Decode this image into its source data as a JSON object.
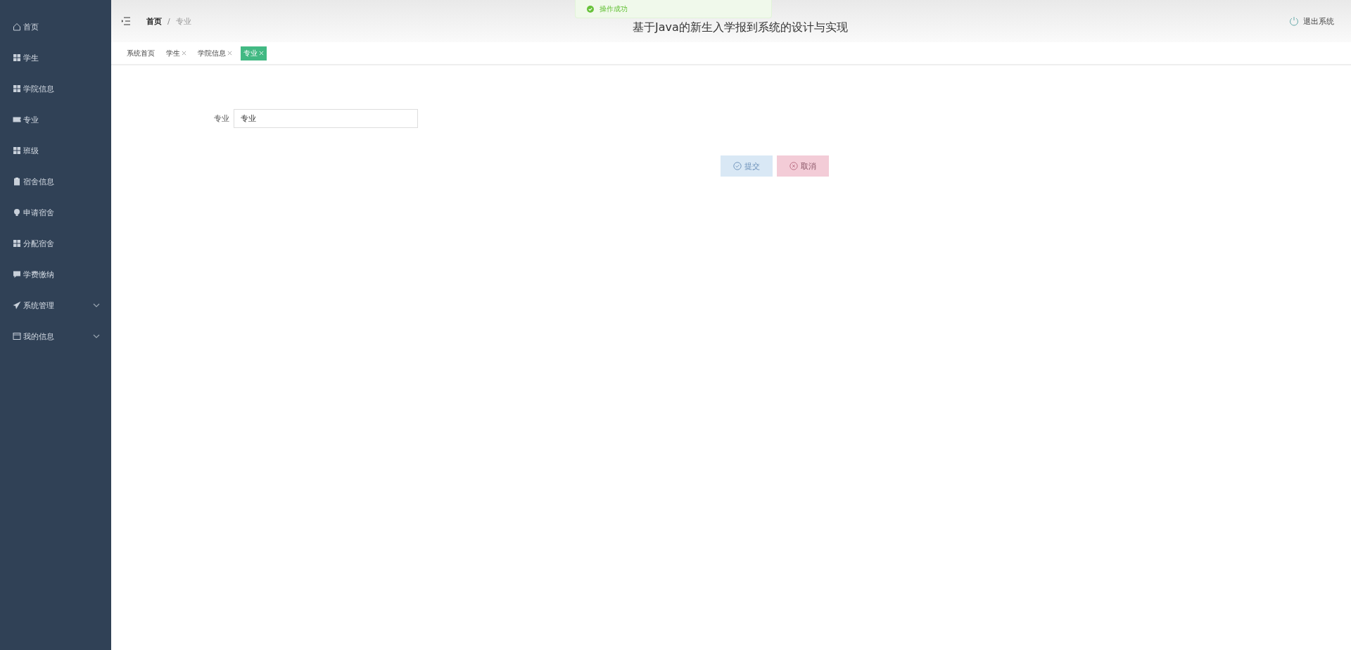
{
  "sidebar": {
    "items": [
      {
        "label": "首页",
        "kind": "home",
        "has_submenu": false
      },
      {
        "label": "学生",
        "kind": "grid",
        "has_submenu": false
      },
      {
        "label": "学院信息",
        "kind": "grid",
        "has_submenu": false
      },
      {
        "label": "专业",
        "kind": "ticket",
        "has_submenu": false
      },
      {
        "label": "班级",
        "kind": "grid",
        "has_submenu": false
      },
      {
        "label": "宿舍信息",
        "kind": "clipboard",
        "has_submenu": false
      },
      {
        "label": "申请宿舍",
        "kind": "bulb",
        "has_submenu": false
      },
      {
        "label": "分配宿舍",
        "kind": "grid",
        "has_submenu": false
      },
      {
        "label": "学费缴纳",
        "kind": "chat",
        "has_submenu": false
      },
      {
        "label": "系统管理",
        "kind": "plane",
        "has_submenu": true
      },
      {
        "label": "我的信息",
        "kind": "window",
        "has_submenu": true
      }
    ]
  },
  "header": {
    "breadcrumb": [
      "首页",
      "专业"
    ],
    "breadcrumb_separator": "/",
    "title": "基于Java的新生入学报到系统的设计与实现",
    "logout": "退出系统"
  },
  "toast": {
    "message": "操作成功"
  },
  "tabs": [
    {
      "label": "系统首页",
      "closable": false,
      "selected": false
    },
    {
      "label": "学生",
      "closable": true,
      "selected": false
    },
    {
      "label": "学院信息",
      "closable": true,
      "selected": false
    },
    {
      "label": "专业",
      "closable": true,
      "selected": true
    }
  ],
  "form": {
    "fields": [
      {
        "label": "专业",
        "value": "专业"
      }
    ],
    "buttons": [
      {
        "label": "提交",
        "kind": "submit"
      },
      {
        "label": "取消",
        "kind": "cancel"
      }
    ]
  }
}
